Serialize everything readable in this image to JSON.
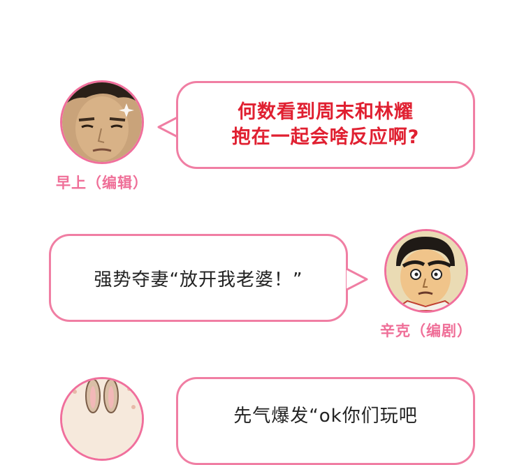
{
  "colors": {
    "accent_pink": "#ef6f98",
    "bubble_border": "#f07ea3",
    "question_red": "#e02031"
  },
  "dialogue": [
    {
      "speaker": "早上（编辑）",
      "text": "何数看到周末和林耀\n抱在一起会啥反应啊?",
      "avatar_icon": "editor-face-avatar"
    },
    {
      "speaker": "辛克（编剧）",
      "text": "强势夺妻“放开我老婆！”",
      "avatar_icon": "cartoon-man-avatar"
    },
    {
      "speaker": "",
      "text": "先气爆发“ok你们玩吧",
      "avatar_icon": "rabbit-avatar"
    }
  ]
}
